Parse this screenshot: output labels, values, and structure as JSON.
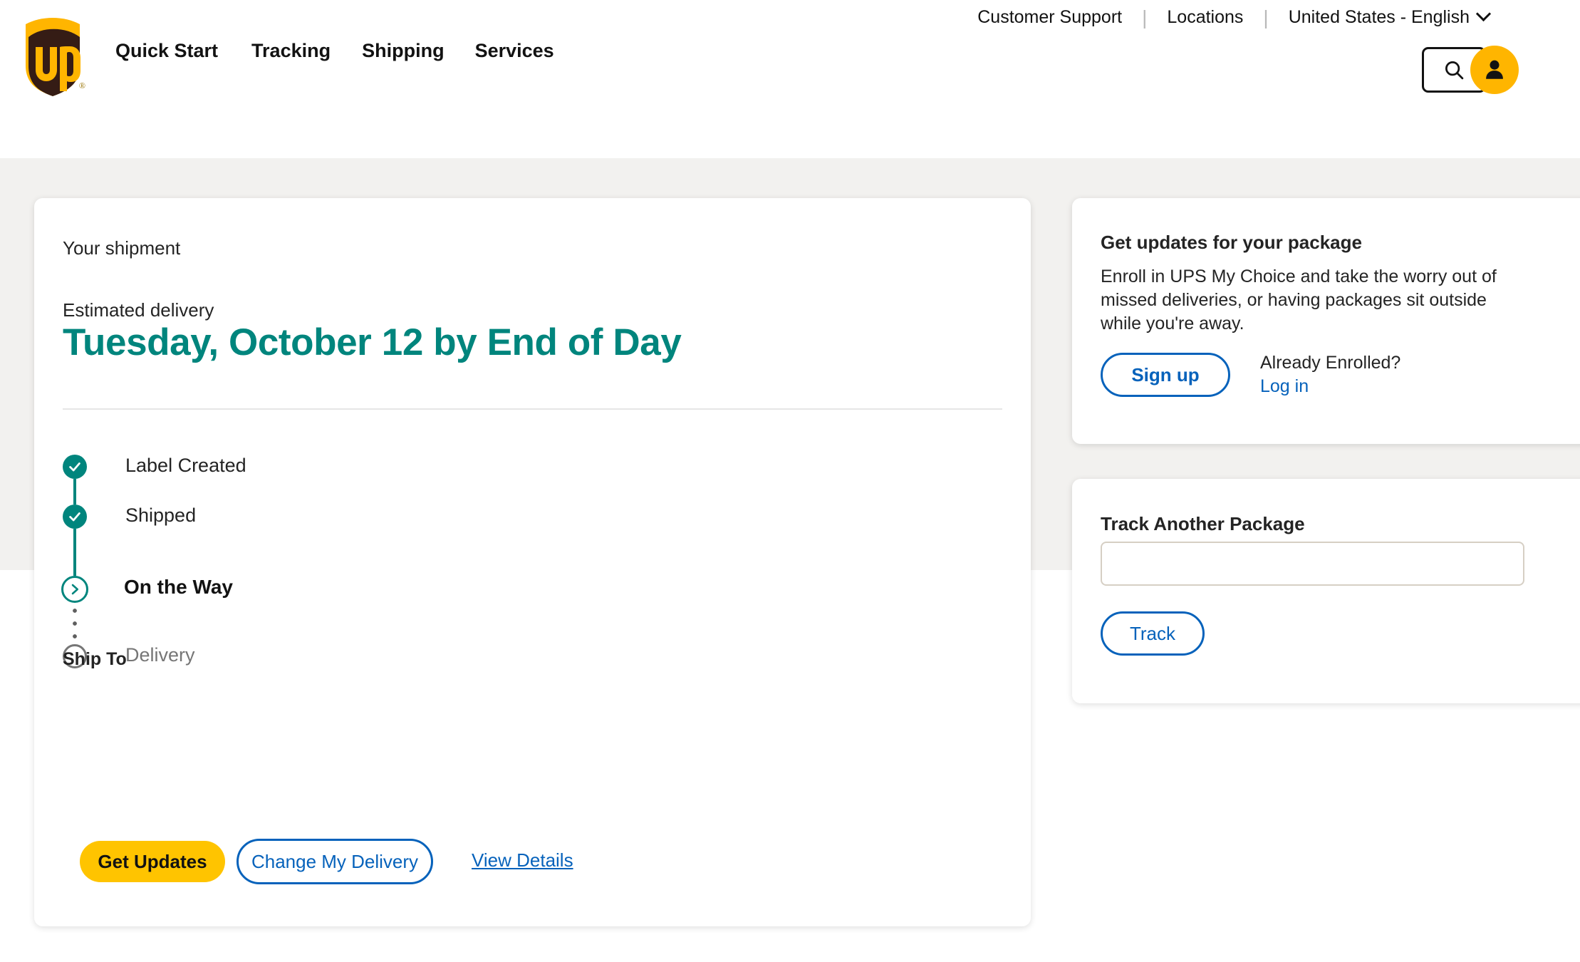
{
  "header": {
    "logo_alt": "UPS",
    "logo_registered_mark": "®",
    "utility_links": [
      {
        "label": "Customer Support"
      },
      {
        "label": "Locations"
      }
    ],
    "separator": "|",
    "locale_selector": "United States - English",
    "main_nav": [
      {
        "label": "Quick Start"
      },
      {
        "label": "Tracking"
      },
      {
        "label": "Shipping"
      },
      {
        "label": "Services"
      }
    ],
    "search_icon": "search-icon",
    "account_icon": "person-icon"
  },
  "shipment": {
    "your_shipment_label": "Your shipment",
    "estimated_delivery_label": "Estimated delivery",
    "estimated_delivery_date": "Tuesday, October 12 by End of Day",
    "accent_color": "#00857d",
    "progress": [
      {
        "label": "Label Created",
        "state": "done"
      },
      {
        "label": "Shipped",
        "state": "done"
      },
      {
        "label": "On the Way",
        "state": "current"
      },
      {
        "label": "Delivery",
        "state": "future"
      }
    ],
    "ship_to_label": "Ship To",
    "ship_to_value": "",
    "actions": {
      "get_updates": "Get Updates",
      "change_my_delivery": "Change My Delivery",
      "view_details": "View Details",
      "primary_color": "#ffc400",
      "link_color": "#0662bb"
    }
  },
  "sidebar": {
    "updates_card": {
      "title": "Get updates for your package",
      "body": "Enroll in UPS My Choice and take the worry out of missed deliveries, or having packages sit outside while you're away.",
      "sign_up_label": "Sign up",
      "already_enrolled_label": "Already Enrolled?",
      "log_in_label": "Log in"
    },
    "track_card": {
      "title": "Track Another Package",
      "input_value": "",
      "input_placeholder": "",
      "track_button_label": "Track"
    }
  }
}
